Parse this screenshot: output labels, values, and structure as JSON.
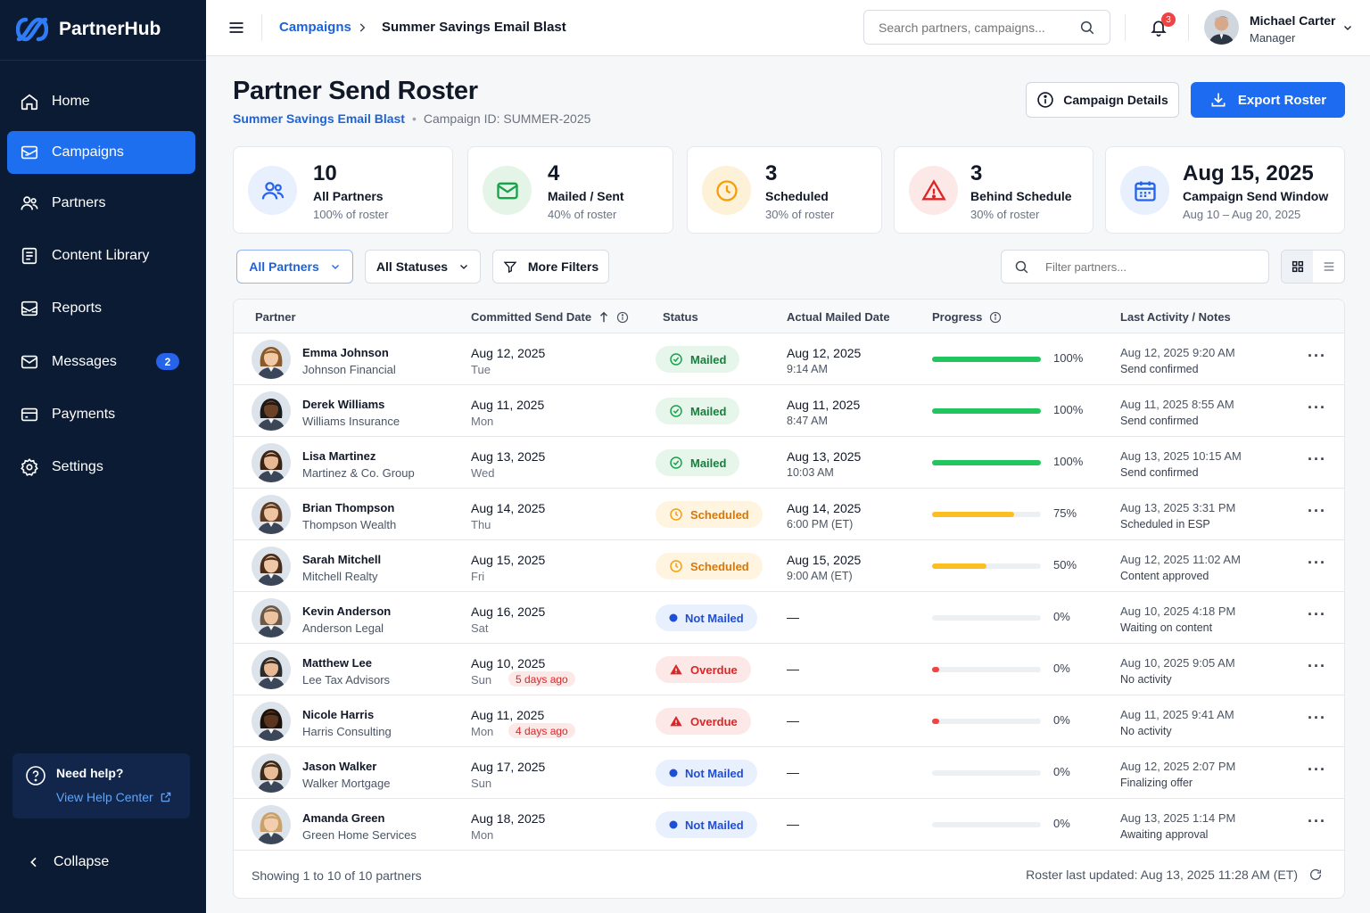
{
  "app": {
    "name": "PartnerHub"
  },
  "sidebar": {
    "items": [
      {
        "label": "Home",
        "icon": "home-icon"
      },
      {
        "label": "Campaigns",
        "icon": "campaigns-icon",
        "active": true
      },
      {
        "label": "Partners",
        "icon": "partners-icon"
      },
      {
        "label": "Content Library",
        "icon": "content-library-icon"
      },
      {
        "label": "Reports",
        "icon": "reports-icon"
      },
      {
        "label": "Messages",
        "icon": "mail-icon",
        "badge": "2"
      },
      {
        "label": "Payments",
        "icon": "payments-icon"
      },
      {
        "label": "Settings",
        "icon": "gear-icon"
      }
    ],
    "help": {
      "title": "Need help?",
      "link": "View Help Center"
    },
    "collapse_label": "Collapse"
  },
  "header": {
    "breadcrumb": [
      "Campaigns",
      "Summer Savings Email Blast"
    ],
    "search_placeholder": "Search partners, campaigns...",
    "notification_count": "3",
    "user": {
      "name": "Michael Carter",
      "role": "Manager"
    }
  },
  "page": {
    "title": "Partner Send Roster",
    "campaign_name": "Summer Savings Email Blast",
    "separator": "•",
    "campaign_id": "Campaign ID: SUMMER-2025",
    "details_button": "Campaign Details",
    "export_button": "Export Roster"
  },
  "stats": [
    {
      "value": "10",
      "label": "All Partners",
      "sub": "100% of roster",
      "icon": "users-icon",
      "color": "#2563eb"
    },
    {
      "value": "4",
      "label": "Mailed / Sent",
      "sub": "40% of roster",
      "icon": "mail-icon",
      "color": "#16a34a"
    },
    {
      "value": "3",
      "label": "Scheduled",
      "sub": "30% of roster",
      "icon": "clock-icon",
      "color": "#f59e0b"
    },
    {
      "value": "3",
      "label": "Behind Schedule",
      "sub": "30% of roster",
      "icon": "warning-icon",
      "color": "#dc2626"
    },
    {
      "value": "Aug 15, 2025",
      "label": "Campaign Send Window",
      "sub": "Aug 10 – Aug 20, 2025",
      "icon": "calendar-icon",
      "color": "#2563eb"
    }
  ],
  "filters": {
    "partners": "All Partners",
    "statuses": "All Statuses",
    "more": "More Filters",
    "search_placeholder": "Filter partners..."
  },
  "table": {
    "columns": [
      "Partner",
      "Committed Send Date",
      "Status",
      "Actual Mailed Date",
      "Progress",
      "Last Activity / Notes"
    ],
    "rows": [
      {
        "name": "Emma Johnson",
        "company": "Johnson Financial",
        "date": "Aug 12, 2025",
        "day": "Tue",
        "late": "",
        "status": "Mailed",
        "mailed_date": "Aug 12, 2025",
        "mailed_time": "9:14 AM",
        "progress": 100,
        "pct": "100%",
        "activity": "Aug 12, 2025 9:20 AM",
        "note": "Send confirmed",
        "hair": "#8a5a2b",
        "skin": "#f2c9a5"
      },
      {
        "name": "Derek Williams",
        "company": "Williams Insurance",
        "date": "Aug 11, 2025",
        "day": "Mon",
        "late": "",
        "status": "Mailed",
        "mailed_date": "Aug 11, 2025",
        "mailed_time": "8:47 AM",
        "progress": 100,
        "pct": "100%",
        "activity": "Aug 11, 2025 8:55 AM",
        "note": "Send confirmed",
        "hair": "#1a1a1a",
        "skin": "#6b4128"
      },
      {
        "name": "Lisa Martinez",
        "company": "Martinez & Co. Group",
        "date": "Aug 13, 2025",
        "day": "Wed",
        "late": "",
        "status": "Mailed",
        "mailed_date": "Aug 13, 2025",
        "mailed_time": "10:03 AM",
        "progress": 100,
        "pct": "100%",
        "activity": "Aug 13, 2025 10:15 AM",
        "note": "Send confirmed",
        "hair": "#3b2314",
        "skin": "#e7b895"
      },
      {
        "name": "Brian Thompson",
        "company": "Thompson Wealth",
        "date": "Aug 14, 2025",
        "day": "Thu",
        "late": "",
        "status": "Scheduled",
        "mailed_date": "Aug 14, 2025",
        "mailed_time": "6:00 PM (ET)",
        "progress": 75,
        "pct": "75%",
        "activity": "Aug 13, 2025 3:31 PM",
        "note": "Scheduled in ESP",
        "hair": "#5a3a22",
        "skin": "#efc4a0"
      },
      {
        "name": "Sarah Mitchell",
        "company": "Mitchell Realty",
        "date": "Aug 15, 2025",
        "day": "Fri",
        "late": "",
        "status": "Scheduled",
        "mailed_date": "Aug 15, 2025",
        "mailed_time": "9:00 AM (ET)",
        "progress": 50,
        "pct": "50%",
        "activity": "Aug 12, 2025 11:02 AM",
        "note": "Content approved",
        "hair": "#4a2c1a",
        "skin": "#f0c7a6"
      },
      {
        "name": "Kevin Anderson",
        "company": "Anderson Legal",
        "date": "Aug 16, 2025",
        "day": "Sat",
        "late": "",
        "status": "Not Mailed",
        "mailed_date": "—",
        "mailed_time": "",
        "progress": 0,
        "pct": "0%",
        "activity": "Aug 10, 2025 4:18 PM",
        "note": "Waiting on content",
        "hair": "#6b5a4a",
        "skin": "#eec3a2"
      },
      {
        "name": "Matthew Lee",
        "company": "Lee Tax Advisors",
        "date": "Aug 10, 2025",
        "day": "Sun",
        "late": "5 days ago",
        "status": "Overdue",
        "mailed_date": "—",
        "mailed_time": "",
        "progress": 3,
        "pct": "0%",
        "activity": "Aug 10, 2025 9:05 AM",
        "note": "No activity",
        "hair": "#2b2b2b",
        "skin": "#e8b994"
      },
      {
        "name": "Nicole Harris",
        "company": "Harris Consulting",
        "date": "Aug 11, 2025",
        "day": "Mon",
        "late": "4 days ago",
        "status": "Overdue",
        "mailed_date": "—",
        "mailed_time": "",
        "progress": 3,
        "pct": "0%",
        "activity": "Aug 11, 2025 9:41 AM",
        "note": "No activity",
        "hair": "#1c120c",
        "skin": "#5a3520"
      },
      {
        "name": "Jason Walker",
        "company": "Walker Mortgage",
        "date": "Aug 17, 2025",
        "day": "Sun",
        "late": "",
        "status": "Not Mailed",
        "mailed_date": "—",
        "mailed_time": "",
        "progress": 0,
        "pct": "0%",
        "activity": "Aug 12, 2025 2:07 PM",
        "note": "Finalizing offer",
        "hair": "#3a2a1e",
        "skin": "#e9bc98"
      },
      {
        "name": "Amanda Green",
        "company": "Green Home Services",
        "date": "Aug 18, 2025",
        "day": "Mon",
        "late": "",
        "status": "Not Mailed",
        "mailed_date": "—",
        "mailed_time": "",
        "progress": 0,
        "pct": "0%",
        "activity": "Aug 13, 2025 1:14 PM",
        "note": "Awaiting approval",
        "hair": "#c9a26a",
        "skin": "#f3cdae"
      }
    ],
    "footer_left": "Showing 1 to 10 of 10 partners",
    "footer_right": "Roster last updated: Aug 13, 2025 11:28 AM (ET)"
  },
  "colors": {
    "brand": "#1d6bf0",
    "sidebar": "#0b1b34",
    "mailed": "#22c55e",
    "scheduled": "#fbbf24",
    "overdue": "#ef4444"
  }
}
